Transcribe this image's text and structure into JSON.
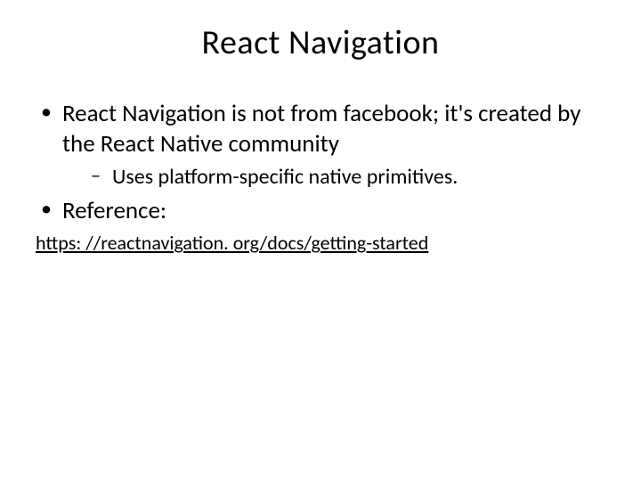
{
  "title": "React Navigation",
  "bullets": [
    {
      "text": "React Navigation is not from facebook; it's created by the React Native community",
      "sub": [
        {
          "text": "Uses platform-specific native primitives."
        }
      ]
    },
    {
      "text": "Reference:"
    }
  ],
  "link": {
    "text": "https: //reactnavigation. org/docs/getting-started",
    "href": "https://reactnavigation.org/docs/getting-started"
  }
}
